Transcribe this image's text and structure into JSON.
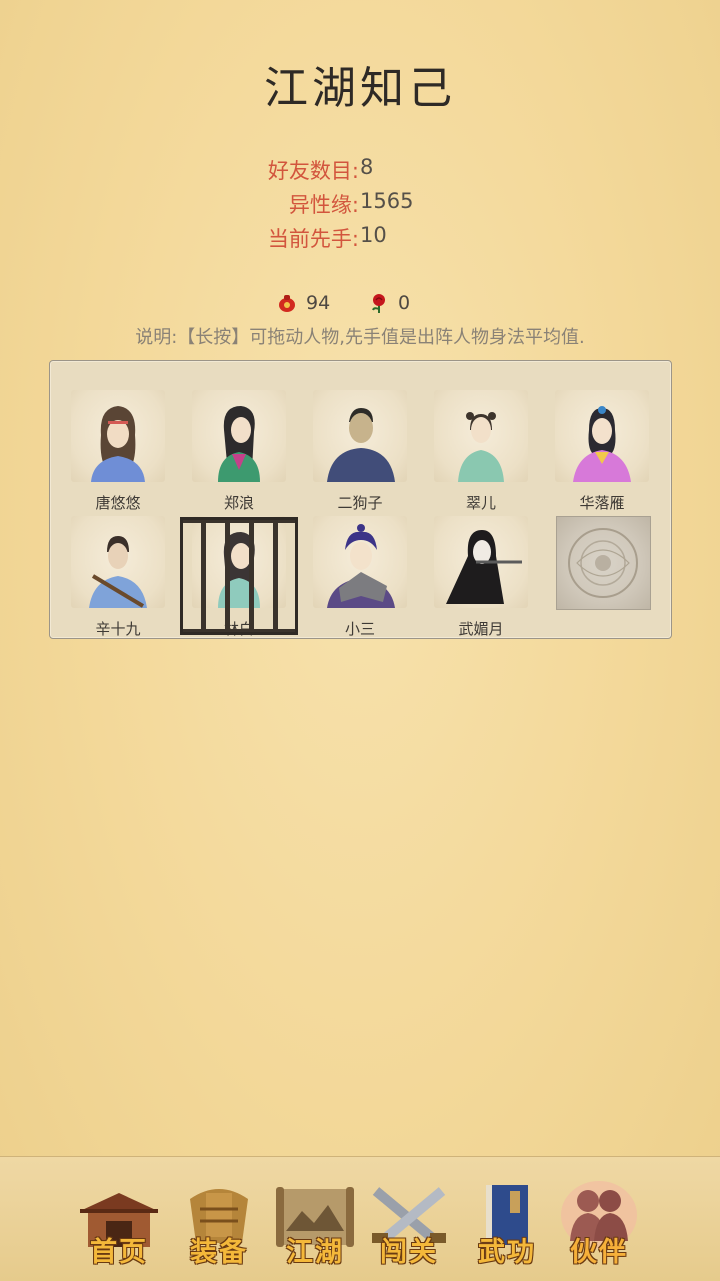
{
  "page": {
    "title": "江湖知己"
  },
  "stats": [
    {
      "label": "好友数目:",
      "value": "8"
    },
    {
      "label": "异性缘:",
      "value": "1565"
    },
    {
      "label": "当前先手:",
      "value": "10"
    }
  ],
  "counters": {
    "red_item": {
      "icon": "red-pouch-icon",
      "value": "94"
    },
    "rose": {
      "icon": "rose-icon",
      "value": "0"
    }
  },
  "note": "说明:【长按】可拖动人物,先手值是出阵人物身法平均值.",
  "characters": [
    {
      "name": "唐悠悠",
      "locked": false
    },
    {
      "name": "郑浪",
      "locked": false
    },
    {
      "name": "二狗子",
      "locked": false
    },
    {
      "name": "翠儿",
      "locked": false
    },
    {
      "name": "华落雁",
      "locked": false
    },
    {
      "name": "辛十九",
      "locked": false
    },
    {
      "name": "林白",
      "locked": true
    },
    {
      "name": "小三",
      "locked": false
    },
    {
      "name": "武媚月",
      "locked": false
    },
    {
      "name": "",
      "empty_slot_icon": "seal-emblem-icon"
    }
  ],
  "nav": [
    {
      "label": "首页",
      "icon": "house-icon"
    },
    {
      "label": "装备",
      "icon": "armor-icon"
    },
    {
      "label": "江湖",
      "icon": "scroll-map-icon"
    },
    {
      "label": "闯关",
      "icon": "crossed-swords-icon"
    },
    {
      "label": "武功",
      "icon": "book-icon"
    },
    {
      "label": "伙伴",
      "icon": "companions-icon",
      "active": true
    }
  ],
  "colors": {
    "accent_label": "#d2553d",
    "nav_label": "#f4b83a"
  }
}
